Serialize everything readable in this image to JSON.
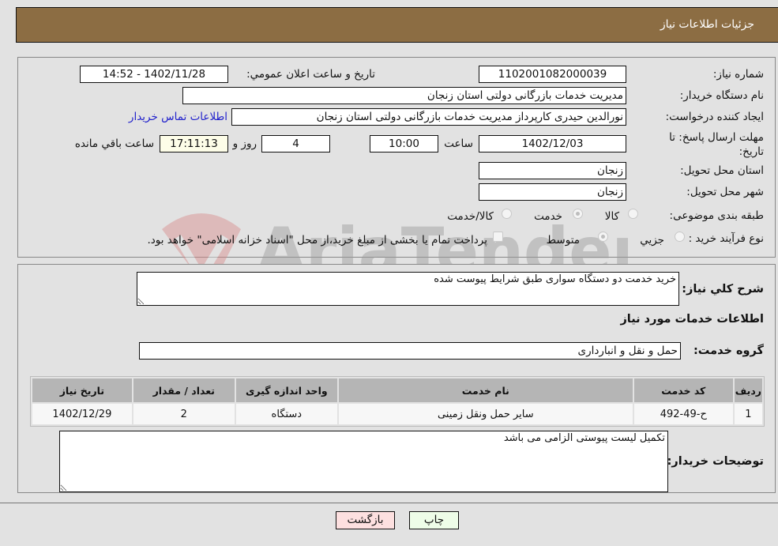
{
  "header": {
    "title": "جزئیات اطلاعات نیاز"
  },
  "form": {
    "need_number": {
      "label": "شماره نیاز:",
      "value": "1102001082000039"
    },
    "announce_datetime": {
      "label": "تاریخ و ساعت اعلان عمومي:",
      "value": "1402/11/28 - 14:52"
    },
    "buyer_org": {
      "label": "نام دستگاه خریدار:",
      "value": "مدیریت خدمات بازرگانی دولتی استان زنجان"
    },
    "requester": {
      "label": "ایجاد کننده درخواست:",
      "value": "نورالدین حیدری کارپرداز مدیریت خدمات بازرگانی دولتی استان زنجان"
    },
    "buyer_contact_link": "اطلاعات تماس خریدار",
    "deadline": {
      "label": "مهلت ارسال پاسخ: تا تاریخ:",
      "date": "1402/12/03",
      "time_label": "ساعت",
      "time": "10:00",
      "days": "4",
      "days_label": "روز و",
      "remaining": "17:11:13",
      "remaining_label": "ساعت باقي مانده"
    },
    "province": {
      "label": "استان محل تحویل:",
      "value": "زنجان"
    },
    "city": {
      "label": "شهر محل تحویل:",
      "value": "زنجان"
    },
    "category": {
      "label": "طبقه بندی موضوعی:",
      "options": [
        "کالا",
        "خدمت",
        "کالا/خدمت"
      ],
      "selected": "خدمت"
    },
    "purchase_process": {
      "label": "نوع فرآیند خرید :",
      "options": [
        "جزيي",
        "متوسط"
      ],
      "selected": "متوسط",
      "treasury_checkbox_label": "پرداخت تمام یا بخشی از مبلغ خرید،از محل \"اسناد خزانه اسلامی\" خواهد بود."
    }
  },
  "details": {
    "summary_label": "شرح کلي نياز:",
    "summary_value": "خرید خدمت دو دستگاه سواری طبق شرایط پیوست شده",
    "services_heading": "اطلاعات خدمات مورد نیاز",
    "service_group_label": "گروه خدمت:",
    "service_group_value": "حمل و نقل و انبارداری",
    "table": {
      "headers": [
        "ردیف",
        "کد خدمت",
        "نام خدمت",
        "واحد اندازه گیری",
        "تعداد / مقدار",
        "تاریخ نیاز"
      ],
      "rows": [
        [
          "1",
          "ح-49-492",
          "سایر حمل ونقل زمینی",
          "دستگاه",
          "2",
          "1402/12/29"
        ]
      ]
    },
    "buyer_notes_label": "توضیحات خریدار:",
    "buyer_notes_value": "تکمیل لیست پیوستی الزامی می باشد"
  },
  "buttons": {
    "print": "چاپ",
    "back": "بازگشت"
  },
  "watermark": {
    "text": "AriaTender.neT"
  },
  "colors": {
    "header": "#8c6d43",
    "link": "#2222cc",
    "print_bg": "#eefde8",
    "back_bg": "#fde0e0"
  }
}
